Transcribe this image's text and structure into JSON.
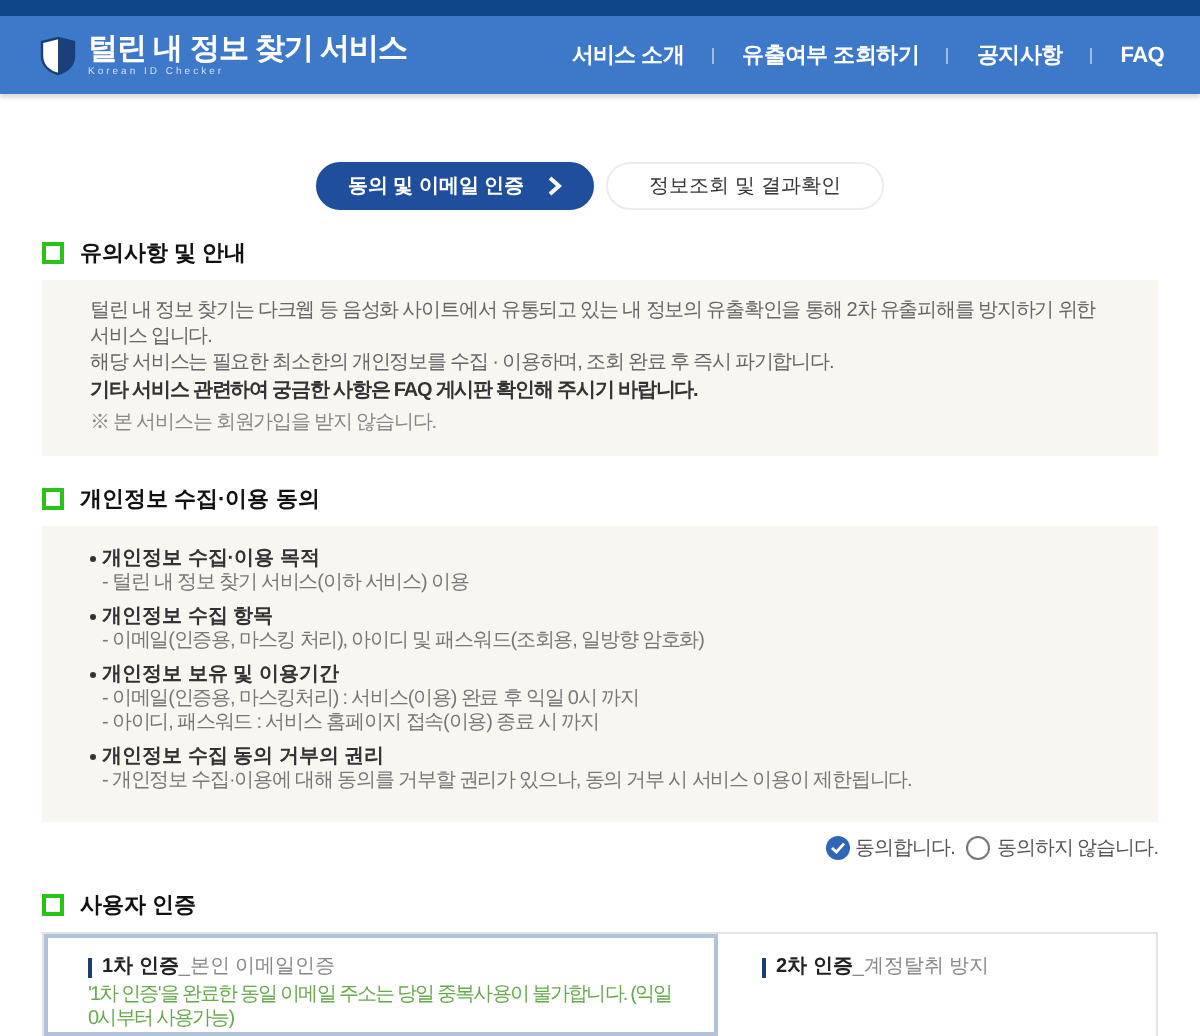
{
  "header": {
    "title": "털린 내 정보 찾기 서비스",
    "subtitle": "Korean ID Checker",
    "nav": [
      "서비스 소개",
      "유출여부 조회하기",
      "공지사항",
      "FAQ"
    ]
  },
  "steps": [
    {
      "label": "동의 및 이메일 인증",
      "selected": true
    },
    {
      "label": "정보조회 및 결과확인",
      "selected": false
    }
  ],
  "notice": {
    "title": "유의사항 및 안내",
    "lines": [
      {
        "kind": "normal",
        "text": "털린 내 정보 찾기는 다크웹 등 음성화 사이트에서 유통되고 있는 내 정보의 유출확인을 통해 2차 유출피해를 방지하기 위한 서비스 입니다."
      },
      {
        "kind": "normal",
        "text": "해당 서비스는 필요한 최소한의 개인정보를 수집 · 이용하며, 조회 완료 후 즉시 파기합니다."
      },
      {
        "kind": "bold",
        "text": "기타 서비스 관련하여 궁금한 사항은 FAQ 게시판 확인해 주시기 바랍니다."
      },
      {
        "kind": "note",
        "text": "※ 본 서비스는 회원가입을 받지 않습니다."
      }
    ]
  },
  "consent": {
    "title": "개인정보 수집·이용 동의",
    "items": [
      {
        "heading": "개인정보 수집·이용 목적",
        "details": [
          "- 털린 내 정보 찾기 서비스(이하 서비스) 이용"
        ]
      },
      {
        "heading": "개인정보 수집 항목",
        "details": [
          "- 이메일(인증용, 마스킹 처리), 아이디 및 패스워드(조회용, 일방향 암호화)"
        ]
      },
      {
        "heading": "개인정보 보유 및 이용기간",
        "details": [
          "- 이메일(인증용, 마스킹처리) : 서비스(이용) 완료 후 익일 0시 까지",
          "- 아이디, 패스워드 : 서비스 홈페이지 접속(이용) 종료 시 까지"
        ]
      },
      {
        "heading": "개인정보 수집 동의 거부의 권리",
        "details": [
          "- 개인정보 수집·이용에 대해 동의를 거부할 권리가 있으나, 동의 거부 시 서비스 이용이 제한됩니다."
        ]
      }
    ],
    "radios": [
      {
        "label": "동의합니다.",
        "selected": true
      },
      {
        "label": "동의하지 않습니다.",
        "selected": false
      }
    ]
  },
  "auth": {
    "title": "사용자 인증",
    "cards": [
      {
        "label": "1차 인증",
        "sub": "_본인 이메일인증",
        "note": "'1차 인증'을 완료한 동일 이메일 주소는 당일 중복사용이 불가합니다. (익일 0시부터 사용가능)",
        "selected": true
      },
      {
        "label": "2차 인증",
        "sub": "_계정탈취 방지",
        "selected": false
      }
    ]
  }
}
